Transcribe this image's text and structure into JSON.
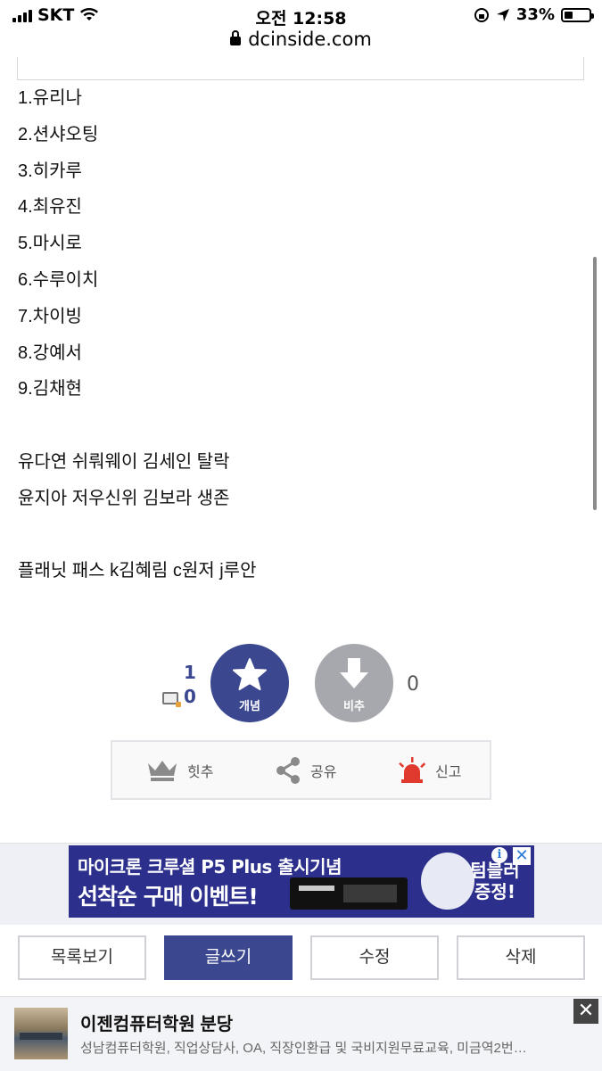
{
  "status": {
    "carrier": "SKT",
    "time": "오전 12:58",
    "battery": "33%",
    "url": "dcinside.com"
  },
  "post": {
    "lines": [
      "1.유리나",
      "2.션샤오팅",
      "3.히카루",
      "4.최유진",
      "5.마시로",
      "6.수루이치",
      "7.차이빙",
      "8.강예서",
      "9.김채현",
      "",
      "유다연 쉬뤄웨이 김세인 탈락",
      "윤지아 저우신위 김보라 생존",
      "",
      "플래닛 패스 k김혜림 c원저 j루안"
    ]
  },
  "recommend": {
    "up_count": "1",
    "fixed_count": "0",
    "up_label": "개념",
    "down_label": "비추",
    "down_count": "0"
  },
  "actions": {
    "hit_label": "힛추",
    "share_label": "공유",
    "report_label": "신고"
  },
  "ad": {
    "line1": "마이크론 크루셜 P5 Plus 출시기념",
    "line2": "선착순 구매 이벤트!",
    "side": "텀블러 증정!",
    "info": "i",
    "close": "✕"
  },
  "buttons": {
    "list": "목록보기",
    "write": "글쓰기",
    "edit": "수정",
    "delete": "삭제"
  },
  "bottom_ad": {
    "title": "이젠컴퓨터학원 분당",
    "desc": "성남컴퓨터학원, 직업상담사, OA, 직장인환급 및 국비지원무료교육, 미금역2번…",
    "close": "✕"
  },
  "colors": {
    "primary": "#3b4890",
    "down_grey": "#a7a8ad",
    "report_red": "#e03a2f"
  }
}
